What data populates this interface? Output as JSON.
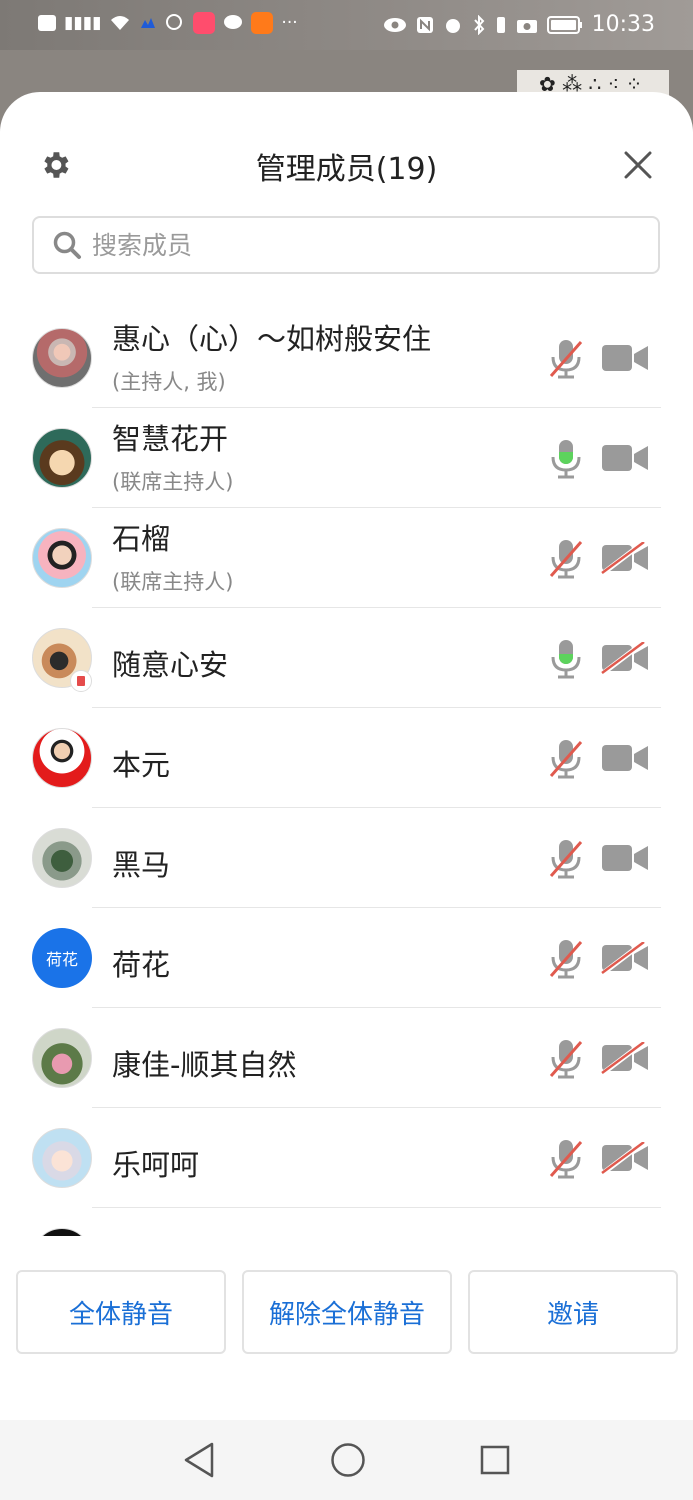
{
  "status_bar": {
    "left_icons": [
      "hd-icon",
      "signal-4g-icon",
      "wifi-icon",
      "app-icon",
      "chat-icon",
      "app-red-icon",
      "message-icon",
      "taobao-icon",
      "more-icon"
    ],
    "right_icons": [
      "eye-icon",
      "nfc-icon",
      "alarm-icon",
      "bluetooth-icon",
      "camera-icon",
      "battery-icon"
    ],
    "time": "10:33"
  },
  "header": {
    "title": "管理成员(19)",
    "settings_icon": "gear-icon",
    "close_icon": "close-icon"
  },
  "search": {
    "placeholder": "搜索成员"
  },
  "members": [
    {
      "name": "惠心（心）～如树般安住",
      "role": "(主持人, 我)",
      "mic": "muted",
      "camera": "on"
    },
    {
      "name": "智慧花开",
      "role": "(联席主持人)",
      "mic": "speaking",
      "camera": "on"
    },
    {
      "name": "石榴",
      "role": "(联席主持人)",
      "mic": "muted",
      "camera": "off"
    },
    {
      "name": "随意心安",
      "role": "",
      "mic": "speaking",
      "camera": "off",
      "badge": "screen-share-icon"
    },
    {
      "name": "本元",
      "role": "",
      "mic": "muted",
      "camera": "on"
    },
    {
      "name": "黑马",
      "role": "",
      "mic": "muted",
      "camera": "on"
    },
    {
      "name": "荷花",
      "role": "",
      "mic": "muted",
      "camera": "off",
      "avatar_text": "荷花"
    },
    {
      "name": "康佳-顺其自然",
      "role": "",
      "mic": "muted",
      "camera": "off"
    },
    {
      "name": "乐呵呵",
      "role": "",
      "mic": "muted",
      "camera": "off"
    }
  ],
  "colors": {
    "accent": "#1a6fd6",
    "mic_speaking": "#5dd35d",
    "muted_slash": "#e05a4e",
    "icon_gray": "#9a9a9a",
    "avatar_text_bg": "#1a73e8"
  },
  "actions": {
    "mute_all": "全体静音",
    "unmute_all": "解除全体静音",
    "invite": "邀请"
  },
  "nav": [
    "back-icon",
    "home-icon",
    "recent-apps-icon"
  ]
}
